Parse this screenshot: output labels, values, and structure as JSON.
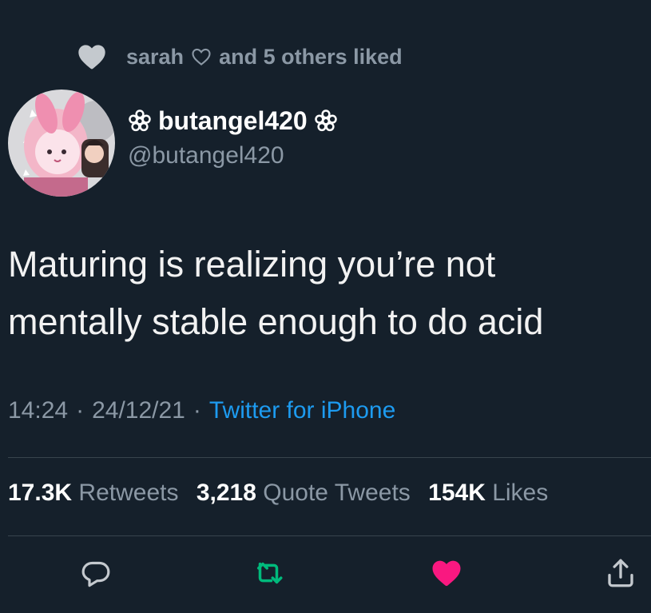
{
  "social_context": {
    "liker_name": "sarah",
    "suffix": "and 5 others liked"
  },
  "author": {
    "display_name": "butangel420",
    "handle": "@butangel420"
  },
  "tweet": {
    "lines": [
      "Maturing is realizing you’re not",
      "mentally stable enough to do acid"
    ]
  },
  "meta": {
    "time": "14:24",
    "separator": "·",
    "date": "24/12/21",
    "source": "Twitter for iPhone"
  },
  "stats": {
    "retweets_count": "17.3K",
    "retweets_label": "Retweets",
    "quotes_count": "3,218",
    "quotes_label": "Quote Tweets",
    "likes_count": "154K",
    "likes_label": "Likes"
  },
  "actions": {
    "reply_icon": "reply-icon",
    "retweet_icon": "retweet-icon",
    "like_icon": "heart-filled-icon",
    "share_icon": "share-icon"
  },
  "colors": {
    "background": "#15202b",
    "secondary_text": "#8b98a5",
    "link": "#1d9bf0",
    "retweet_green": "#00ba7c",
    "like_pink": "#f91880"
  }
}
